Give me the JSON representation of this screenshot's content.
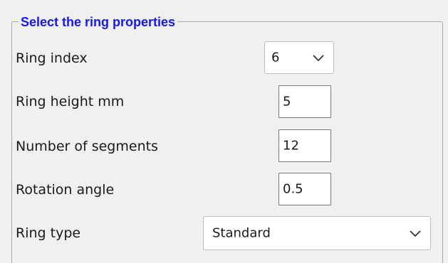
{
  "group": {
    "title": "Select the ring properties"
  },
  "fields": {
    "ring_index": {
      "label": "Ring index",
      "value": "6"
    },
    "ring_height": {
      "label": "Ring height mm",
      "value": "5"
    },
    "num_segments": {
      "label": "Number of segments",
      "value": "12"
    },
    "rotation_angle": {
      "label": "Rotation angle",
      "value": "0.5"
    },
    "ring_type": {
      "label": "Ring type",
      "value": "Standard"
    }
  },
  "icons": {
    "dropdown": "chevron-down-icon"
  },
  "colors": {
    "background": "#f0f0f0",
    "group_title": "#1515ff",
    "field_background": "#ffffff"
  }
}
